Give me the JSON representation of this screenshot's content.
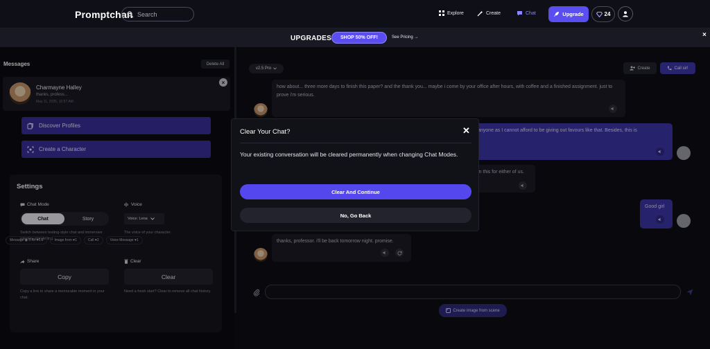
{
  "nav": {
    "brand": "Promptchan",
    "search_placeholder": "Search",
    "explore": "Explore",
    "create": "Create",
    "chat": "Chat",
    "upgrade": "Upgrade",
    "gems": "24"
  },
  "promo": {
    "title": "UPGRADES",
    "shop": "SHOP 50% OFF!",
    "see_pricing": "See Pricing →",
    "close": "×"
  },
  "sidebar": {
    "messages_title": "Messages",
    "delete_all": "Delete All",
    "chat_item": {
      "name": "Charmayne Halley",
      "preview": "thanks, profess...",
      "date": "May 11, 2025, 10:57 AM"
    },
    "discover": "Discover Profiles",
    "create_character": "Create a Character"
  },
  "settings": {
    "title": "Settings",
    "chat_mode_label": "Chat Mode",
    "chat_mode_on": "Chat",
    "chat_mode_off": "Story",
    "chat_mode_hint": "Switch between texting-style chat and immersive roleplay storytelling.",
    "voice_label": "Voice",
    "voice_value": "Voice: Lena",
    "voice_hint": "The voice of your character.",
    "share_label": "Share",
    "copy_btn": "Copy",
    "share_hint": "Copy a link to share a memorable moment in your chat.",
    "clear_label": "Clear",
    "clear_btn": "Clear",
    "clear_hint": "Need a fresh start? Clear to remove all chat history.",
    "chips": [
      "Message  ◉ 5 /th  ♥0.6",
      "Image  from  ♥1",
      "Call  ♥2",
      "Voice Message  ♥1"
    ]
  },
  "chat": {
    "model": "v2.5 Pro",
    "create": "Create",
    "call": "Call sir!",
    "messages": [
      "how about... three more days to finish this paper? and the thank you... maybe i come by your office after hours, with coffee and a finished assignment. just to prove i'm serious.",
      "anyone as I cannot afford to be giving out favours like that. Besides, this is",
      "in this for either of us.",
      "Good girl",
      "thanks, professor. i'll be back tomorrow night. promise."
    ],
    "scene_btn": "Create image from scene"
  },
  "modal": {
    "title": "Clear Your Chat?",
    "close": "✕",
    "text": "Your existing conversation will be cleared permanently when changing Chat Modes.",
    "primary": "Clear And Continue",
    "secondary": "No, Go Back"
  },
  "colors": {
    "accent": "#5b4ef0",
    "background": "#0d0d14",
    "panel": "#15151d",
    "user_bubble": "#3d35a6"
  }
}
